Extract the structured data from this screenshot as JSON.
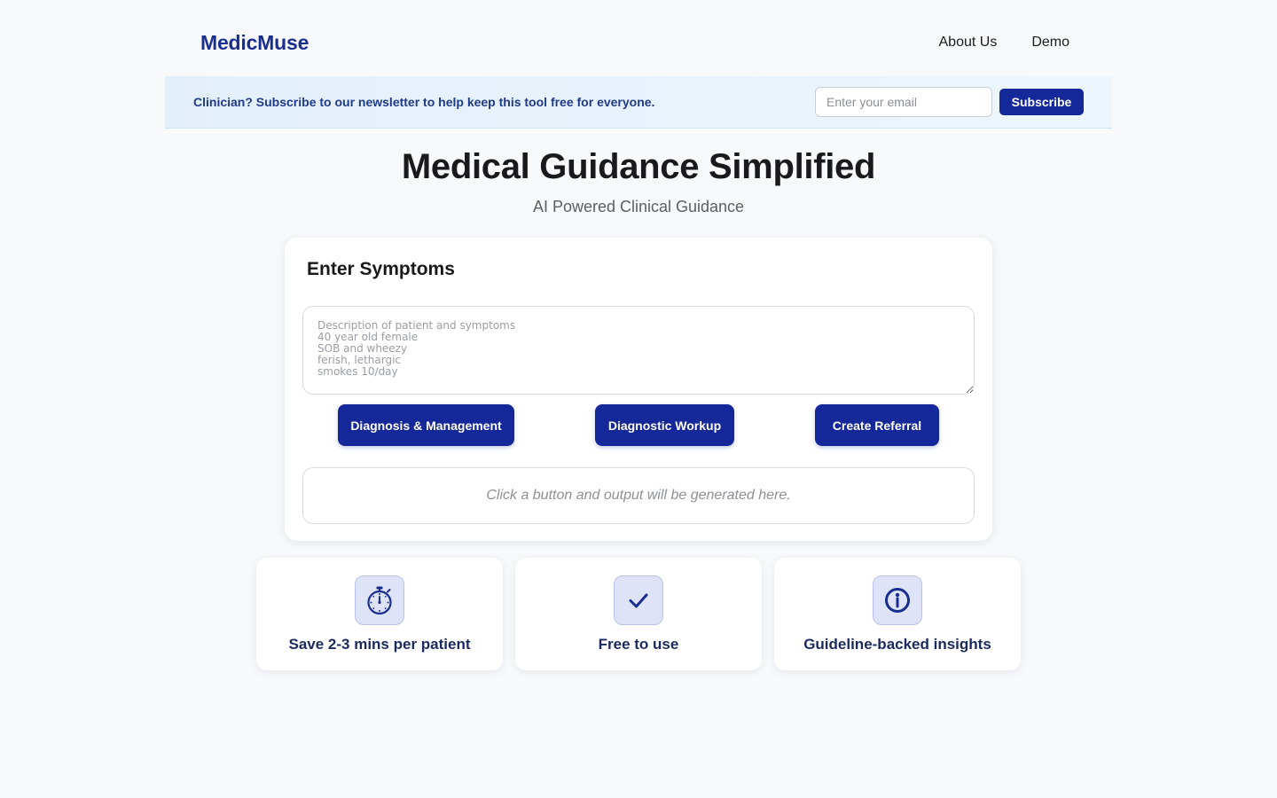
{
  "header": {
    "brand": "MedicMuse",
    "nav": [
      {
        "label": "About Us"
      },
      {
        "label": "Demo"
      }
    ]
  },
  "newsletter": {
    "text": "Clinician? Subscribe to our newsletter to help keep this tool free for everyone.",
    "email_placeholder": "Enter your email",
    "subscribe_label": "Subscribe"
  },
  "hero": {
    "title": "Medical Guidance Simplified",
    "subtitle": "AI Powered Clinical Guidance"
  },
  "symptoms_card": {
    "title": "Enter Symptoms",
    "textarea_placeholder": "Description of patient and symptoms\n40 year old female\nSOB and wheezy\nferish, lethargic\nsmokes 10/day",
    "buttons": [
      {
        "label": "Diagnosis & Management"
      },
      {
        "label": "Diagnostic Workup"
      },
      {
        "label": "Create Referral"
      }
    ],
    "output_placeholder": "Click a button and output will be generated here."
  },
  "features": [
    {
      "label": "Save 2-3 mins per patient",
      "icon": "stopwatch-icon"
    },
    {
      "label": "Free to use",
      "icon": "checkmark-icon"
    },
    {
      "label": "Guideline-backed insights",
      "icon": "info-icon"
    }
  ],
  "colors": {
    "brand": "#1a2e8f",
    "primary_button": "#15289a",
    "banner_bg": "#e8f2fc",
    "page_bg": "#f7f9fb",
    "icon_bg": "#dee3f7"
  }
}
